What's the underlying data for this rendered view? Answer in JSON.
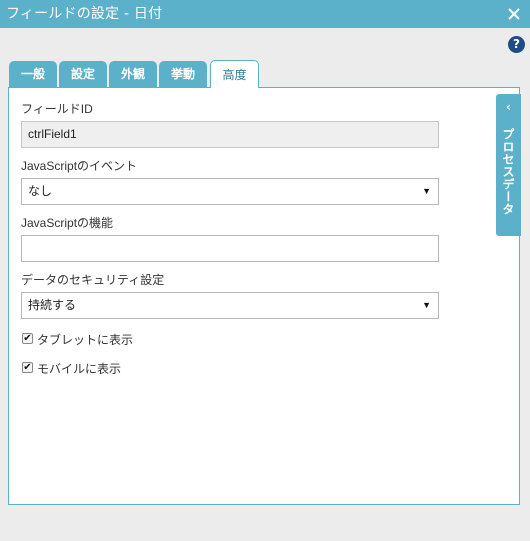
{
  "window": {
    "title": "フィールドの設定 - 日付"
  },
  "tabs": [
    {
      "label": "一般"
    },
    {
      "label": "設定"
    },
    {
      "label": "外観"
    },
    {
      "label": "挙動"
    },
    {
      "label": "高度"
    }
  ],
  "active_tab": "高度",
  "help_glyph": "?",
  "form": {
    "field_id_label": "フィールドID",
    "field_id_value": "ctrlField1",
    "js_event_label": "JavaScriptのイベント",
    "js_event_value": "なし",
    "js_function_label": "JavaScriptの機能",
    "js_function_value": "",
    "security_label": "データのセキュリティ設定",
    "security_value": "持続する",
    "tablet_label": "タブレットに表示",
    "tablet_checked": true,
    "mobile_label": "モバイルに表示",
    "mobile_checked": true
  },
  "side_panel": {
    "label": "プロセスデータ"
  },
  "colors": {
    "accent": "#5bb1c9",
    "help": "#1e4d86",
    "active_tab_text": "#2f7e97"
  }
}
